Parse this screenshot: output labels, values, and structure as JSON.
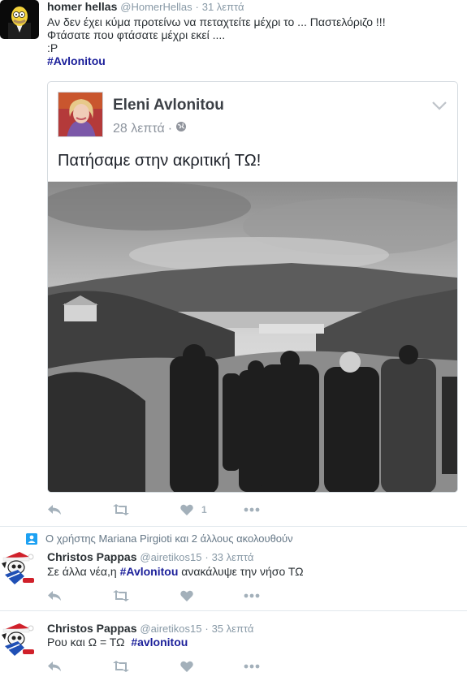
{
  "tweets": [
    {
      "name": "homer hellas",
      "handle": "@HomerHellas",
      "dot": "·",
      "time": "31 λεπτά",
      "lines": [
        "Αν δεν έχει κύμα προτείνω να πεταχτείτε μέχρι το ... Παστελόριζο !!!",
        "Φτάσατε που φτάσατε μέχρι εκεί ....",
        ":P"
      ],
      "hashtag": "#Avlonitou",
      "card": {
        "author": "Eleni Avlonitou",
        "time": "28 λεπτά",
        "dot": "·",
        "text": "Πατήσαμε στην ακριτική ΤΩ!"
      },
      "like_count": "1"
    },
    {
      "context": "Ο χρήστης Mariana Pirgioti και 2 άλλους ακολουθούν",
      "name": "Christos Pappas",
      "handle": "@airetikos15",
      "dot": "·",
      "time": "33 λεπτά",
      "text_before": "Σε άλλα νέα,η ",
      "hashtag": "#Avlonitou",
      "text_after": " ανακάλυψε την νήσο ΤΩ"
    },
    {
      "name": "Christos Pappas",
      "handle": "@airetikos15",
      "dot": "·",
      "time": "35 λεπτά",
      "text_before": "Ρου και Ω = ΤΩ  ",
      "hashtag": "#avlonitou"
    }
  ],
  "icons": {
    "reply": "reply-icon",
    "retweet": "retweet-icon",
    "like": "heart-icon",
    "more": "more-icon",
    "globe": "globe-icon",
    "chevron": "chevron-down-icon",
    "follow": "user-follow-icon"
  },
  "colors": {
    "hashtag": "#1b1f9a",
    "action": "#a3b0ba",
    "muted": "#8899a6"
  }
}
